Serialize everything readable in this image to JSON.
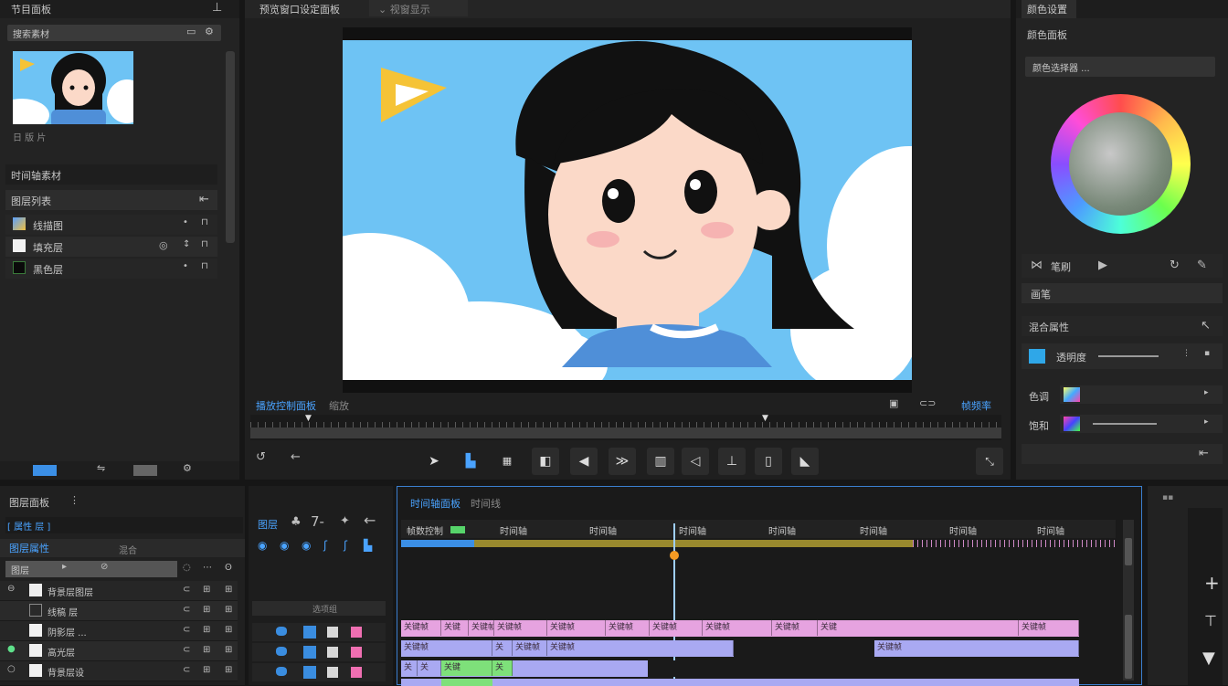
{
  "project_panel": {
    "title": "节目面板",
    "search_value": "搜索素材",
    "thumb_caption": "日 版 片",
    "section_title": "时间轴素材",
    "list_header": "图层列表",
    "items": [
      {
        "label": "线描图"
      },
      {
        "label": "填充层"
      },
      {
        "label": "黑色层"
      }
    ]
  },
  "viewer": {
    "title": "预览窗口设定面板",
    "tab": "⌄ 视窗显示",
    "bottom_label": "播放控制面板",
    "bottom_label2": "缩放",
    "bottom_right": "帧频率"
  },
  "right_panel": {
    "title": "颜色设置",
    "subtitle": "颜色面板",
    "dropdown": "颜色选择器 ...",
    "brush_label": "笔刷",
    "section2": "画笔",
    "section3": "混合属性",
    "row1_label": "透明度",
    "row2_label": "色调",
    "row3_label": "饱和"
  },
  "layers_panel": {
    "title": "图层面板",
    "tabs_left": "[ 属性 层 ]",
    "subheader": "图层属性",
    "subheader2": "混合",
    "mode_label": "图层",
    "rows": [
      {
        "name": "背景层图层"
      },
      {
        "name": "线稿 层"
      },
      {
        "name": "阴影层 ..."
      },
      {
        "name": "高光层"
      },
      {
        "name": "背景层设"
      }
    ]
  },
  "mid_tools": {
    "label": "图层",
    "group_label": "选项组"
  },
  "timeline": {
    "title": "时间轴面板",
    "tab2": "时间线",
    "header_label": "帧数控制",
    "ticks": [
      "时间轴",
      "时间轴",
      "时间轴",
      "时间轴",
      "时间轴",
      "时间轴",
      "时间轴"
    ],
    "clips_row1": [
      "关键帧",
      "关键",
      "关键帧",
      "关键帧",
      "关键帧",
      "关键帧",
      "关键帧",
      "关键帧",
      "关键帧",
      "关键",
      "关键帧"
    ],
    "clips_row2": [
      "关键帧",
      "关",
      "关键帧",
      "关键帧",
      "关键帧"
    ],
    "clips_row3": [
      "关",
      "关",
      "关键",
      "关"
    ]
  },
  "colors": {
    "accent": "#4aa3ff",
    "playhead": "#f59a23",
    "clip_pink": "#e6a3e0",
    "clip_purple": "#a9a9f2",
    "clip_green": "#7ee07a",
    "sky": "#6ec3f4"
  },
  "icons": [
    "pin-icon",
    "folder-icon",
    "gear-icon",
    "search-icon",
    "arrow-left-icon",
    "play-icon",
    "pause-icon",
    "skip-icon",
    "plus-icon",
    "pen-icon",
    "link-icon",
    "eye-icon",
    "lock-icon"
  ]
}
